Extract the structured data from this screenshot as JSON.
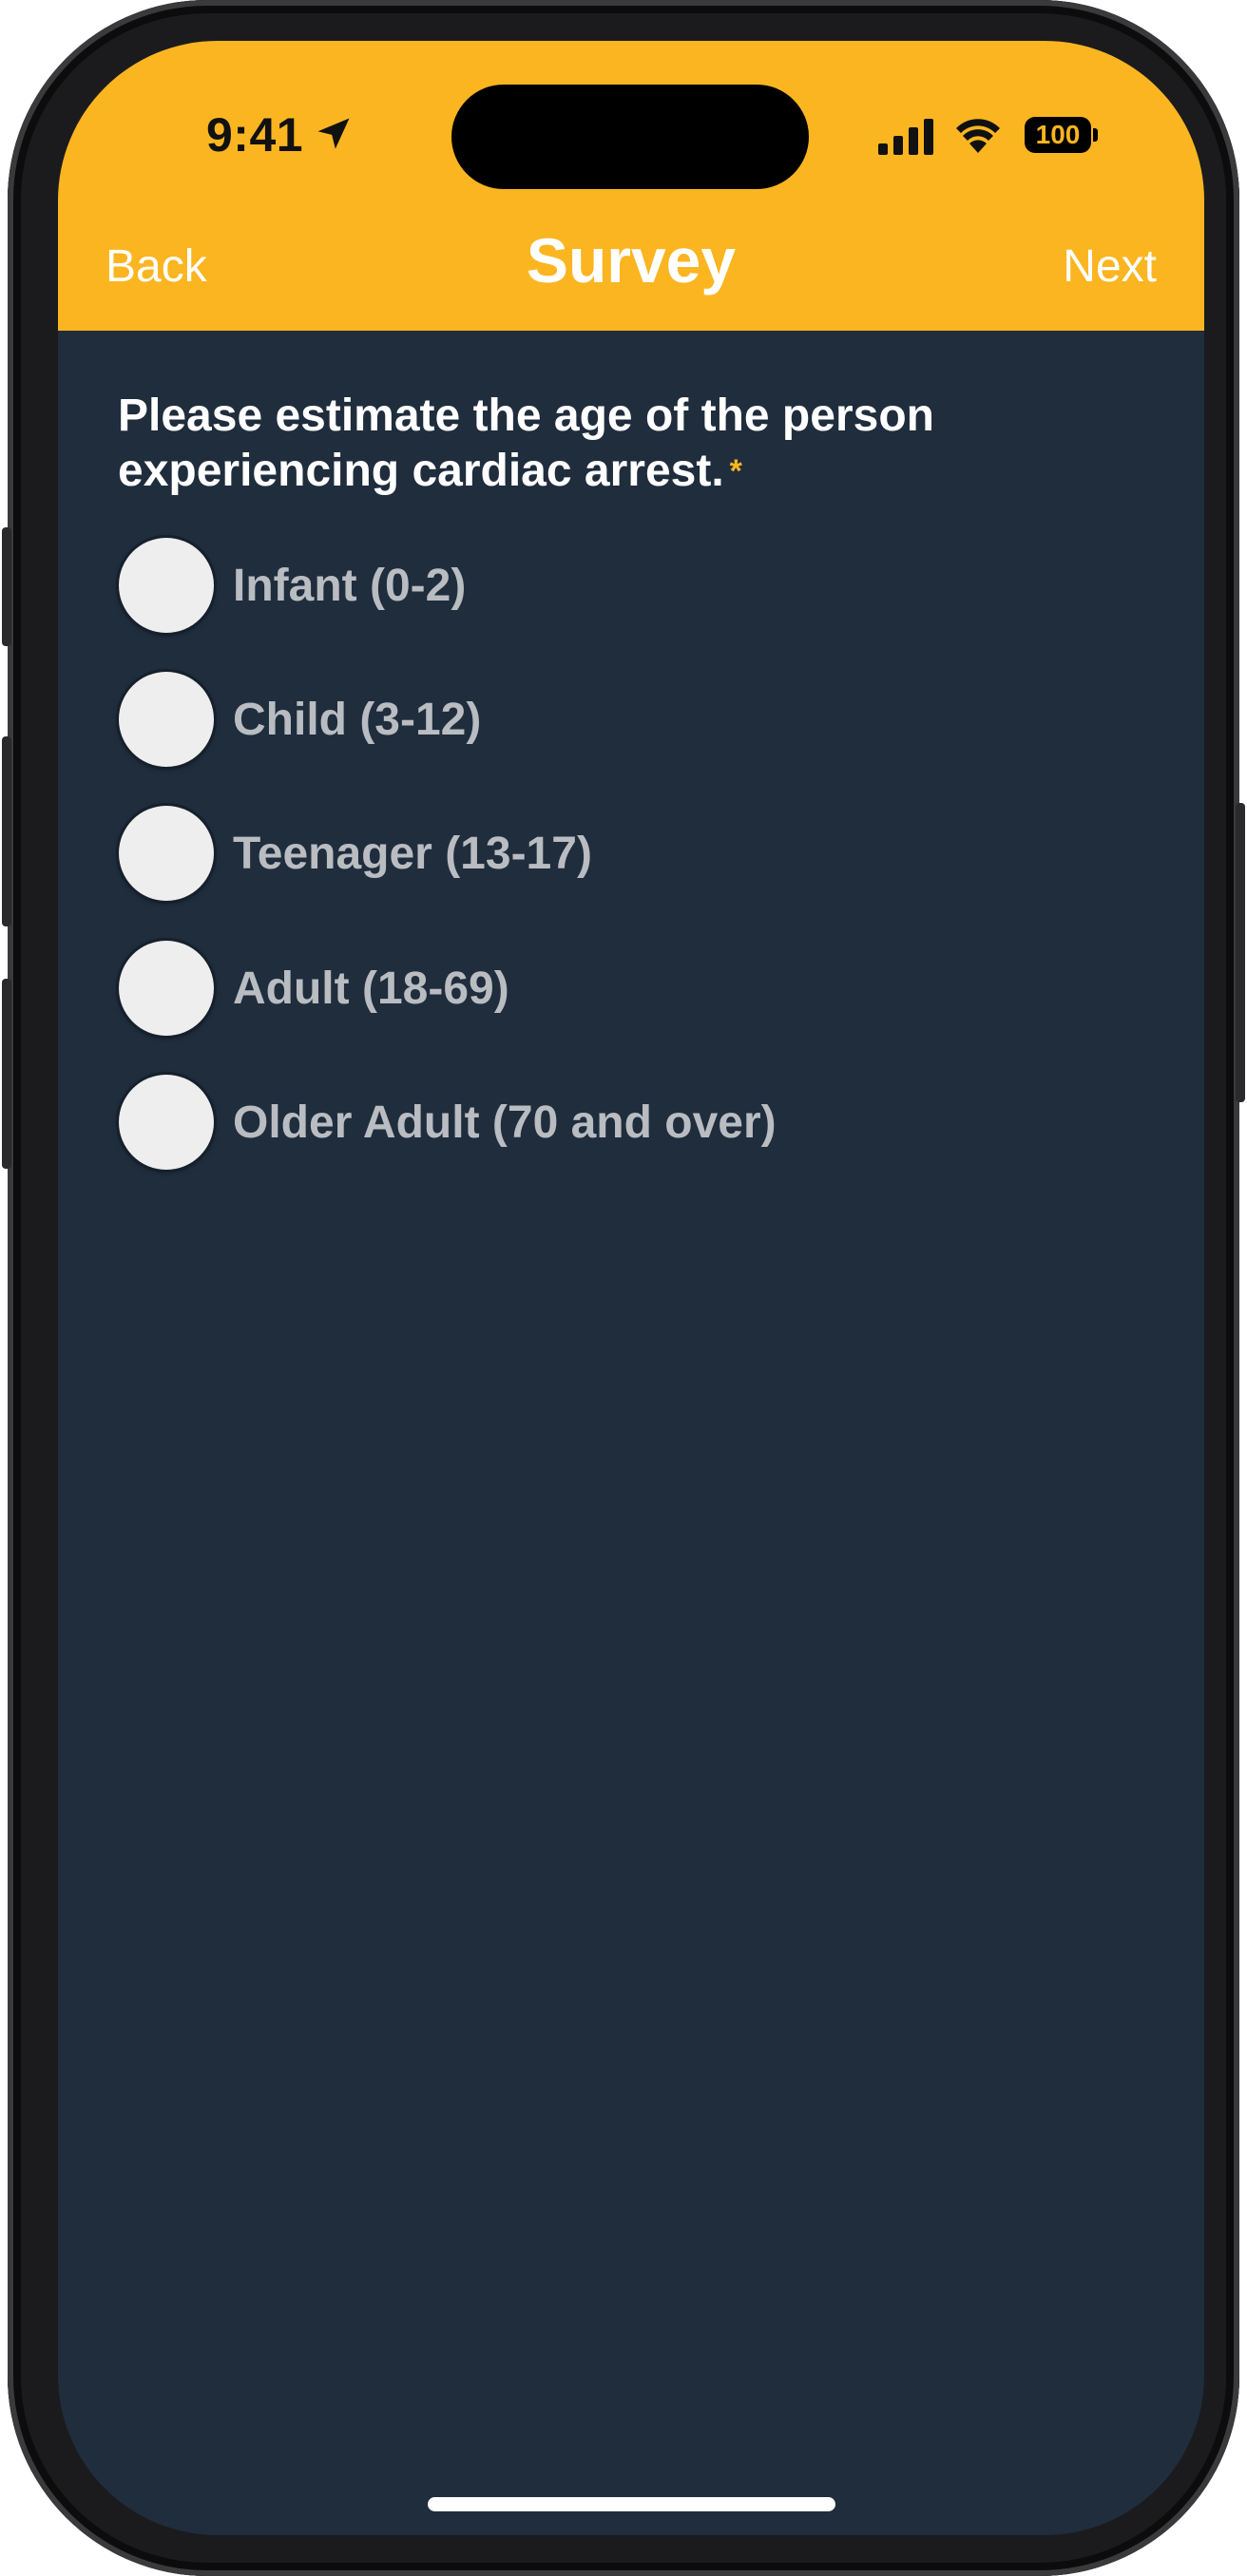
{
  "colors": {
    "header_bg": "#fbb520",
    "screen_bg": "#1f2d3d",
    "accent": "#fbb520",
    "option_text": "#b9bcc1",
    "radio_fill": "#efeeee"
  },
  "status_bar": {
    "time": "9:41",
    "battery": "100",
    "icons": [
      "location-arrow-icon",
      "cellular-signal-icon",
      "wifi-icon",
      "battery-icon"
    ]
  },
  "nav": {
    "back_label": "Back",
    "title": "Survey",
    "next_label": "Next"
  },
  "question": {
    "text": "Please estimate the age of the person experiencing cardiac arrest.",
    "required_marker": "*"
  },
  "options": [
    {
      "label": "Infant (0-2)",
      "selected": false
    },
    {
      "label": "Child (3-12)",
      "selected": false
    },
    {
      "label": "Teenager (13-17)",
      "selected": false
    },
    {
      "label": "Adult (18-69)",
      "selected": false
    },
    {
      "label": "Older Adult (70 and over)",
      "selected": false
    }
  ]
}
